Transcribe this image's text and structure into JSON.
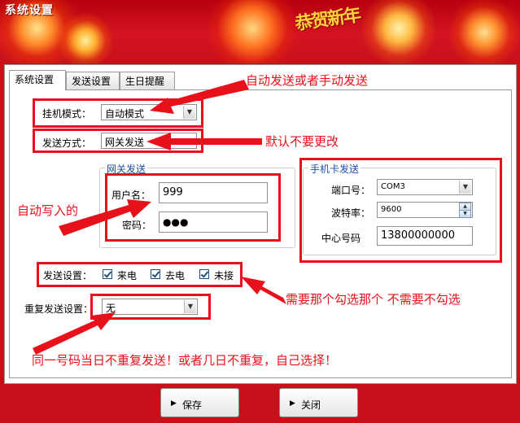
{
  "window": {
    "title": "系统设置",
    "banner_greeting": "恭贺新年"
  },
  "tabs": [
    {
      "label": "系统设置",
      "active": true
    },
    {
      "label": "发送设置",
      "active": false
    },
    {
      "label": "生日提醒",
      "active": false
    }
  ],
  "settings": {
    "hang_mode": {
      "label": "挂机模式：",
      "value": "自动模式"
    },
    "send_method": {
      "label": "发送方式：",
      "value": "网关发送"
    },
    "gateway": {
      "title": "网关发送",
      "username_label": "用户名：",
      "username_value": "999",
      "password_label": "密码：",
      "password_value": "●●●"
    },
    "sim_card": {
      "title": "手机卡发送",
      "port_label": "端口号：",
      "port_value": "COM3",
      "baud_label": "波特率：",
      "baud_value": "9600",
      "center_label": "中心号码",
      "center_value": "13800000000"
    },
    "send_settings": {
      "label": "发送设置：",
      "options": [
        {
          "label": "来电",
          "checked": true
        },
        {
          "label": "去电",
          "checked": true
        },
        {
          "label": "未接",
          "checked": true
        }
      ]
    },
    "repeat": {
      "label": "重复发送设置：",
      "value": "无"
    }
  },
  "annotations": {
    "auto_or_manual": "自动发送或者手动发送",
    "default_no_change": "默认不要更改",
    "auto_written": "自动写入的",
    "check_needed": "需要那个勾选那个 不需要不勾选",
    "repeat_note": "同一号码当日不重复发送！或者几日不重复，自己选择！"
  },
  "footer": {
    "save_label": "保存",
    "close_label": "关闭"
  },
  "colors": {
    "annotation_red": "#e8101a",
    "banner_red": "#c8101a",
    "group_title_blue": "#1f4ea8"
  }
}
